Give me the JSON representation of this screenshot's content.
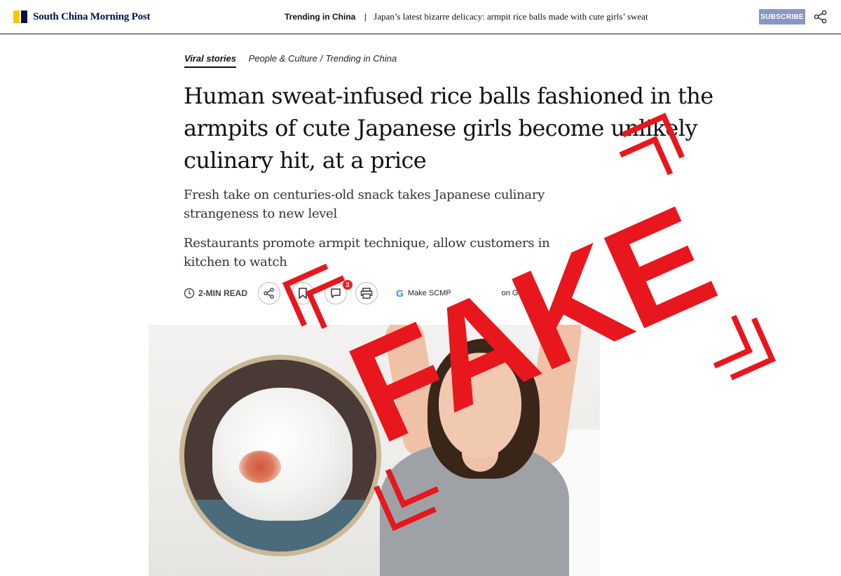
{
  "header": {
    "logo_text": "South China Morning Post",
    "trending_label": "Trending in China",
    "trending_separator": "|",
    "trending_text": "Japan’s latest bizarre delicacy: armpit rice balls made with cute girls’ sweat",
    "subscribe_label": "SUBSCRIBE",
    "share_icon": "share-icon"
  },
  "breadcrumb": {
    "section": "Viral stories",
    "path": [
      "People & Culture",
      "Trending in China"
    ],
    "separator": "/"
  },
  "article": {
    "headline": "Human sweat-infused rice balls fashioned in the armpits of cute Japanese girls become unlikely culinary hit, at a price",
    "subheads": [
      "Fresh take on centuries-old snack takes Japanese culinary strangeness to new level",
      "Restaurants promote armpit technique, allow customers in kitchen to watch"
    ]
  },
  "actions": {
    "read_time": "2-MIN READ",
    "comment_count": "3",
    "google_pill": "Make SCMP",
    "google_pill_tail": "on Googl",
    "google_letter": "G"
  },
  "overlay": {
    "stamp_text": "FAKE",
    "stamp_color": "#e8161d"
  },
  "colors": {
    "brand_navy": "#001246",
    "brand_yellow": "#ffc400",
    "subscribe_bg": "#8a96c2",
    "badge_red": "#e3242b"
  }
}
